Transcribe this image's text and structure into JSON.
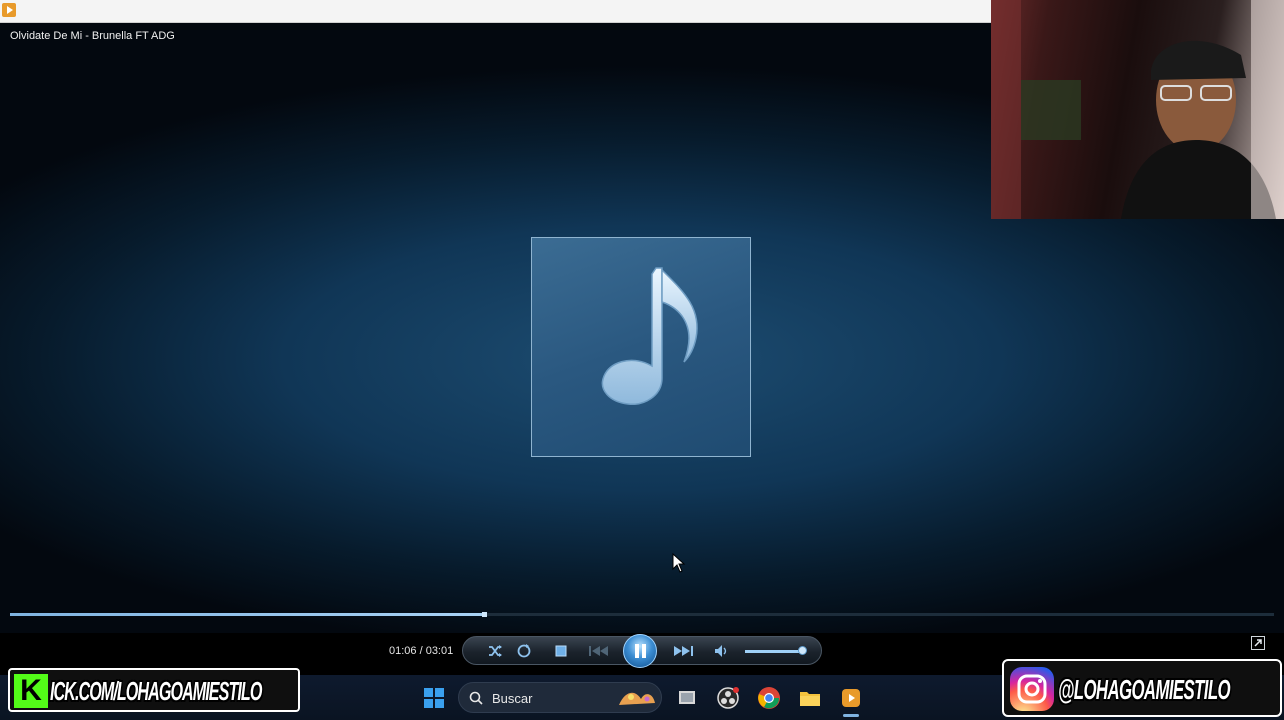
{
  "window": {
    "title": "Olvidate De Mi - Brunella FT ADG"
  },
  "player": {
    "elapsed": "01:06",
    "duration": "03:01",
    "time_display": "01:06 / 03:01",
    "progress_fraction": 0.375,
    "volume_fraction": 0.95,
    "state": "playing",
    "accent_color": "#3d8ed3"
  },
  "controls": [
    {
      "name": "shuffle-icon"
    },
    {
      "name": "repeat-icon"
    },
    {
      "name": "stop-icon"
    },
    {
      "name": "previous-icon"
    },
    {
      "name": "pause-icon"
    },
    {
      "name": "next-icon"
    },
    {
      "name": "volume-icon"
    }
  ],
  "taskbar": {
    "search_placeholder": "Buscar",
    "icons": [
      "windows-start-icon",
      "search-icon",
      "widgets-icon",
      "task-view-icon",
      "obs-icon",
      "chrome-icon",
      "file-explorer-icon",
      "media-player-icon"
    ]
  },
  "overlays": {
    "kick_url": "ICK.COM/LOHAGOAMIESTILO",
    "kick_letter": "K",
    "instagram_handle": "@LOHAGOAMIESTILO"
  }
}
